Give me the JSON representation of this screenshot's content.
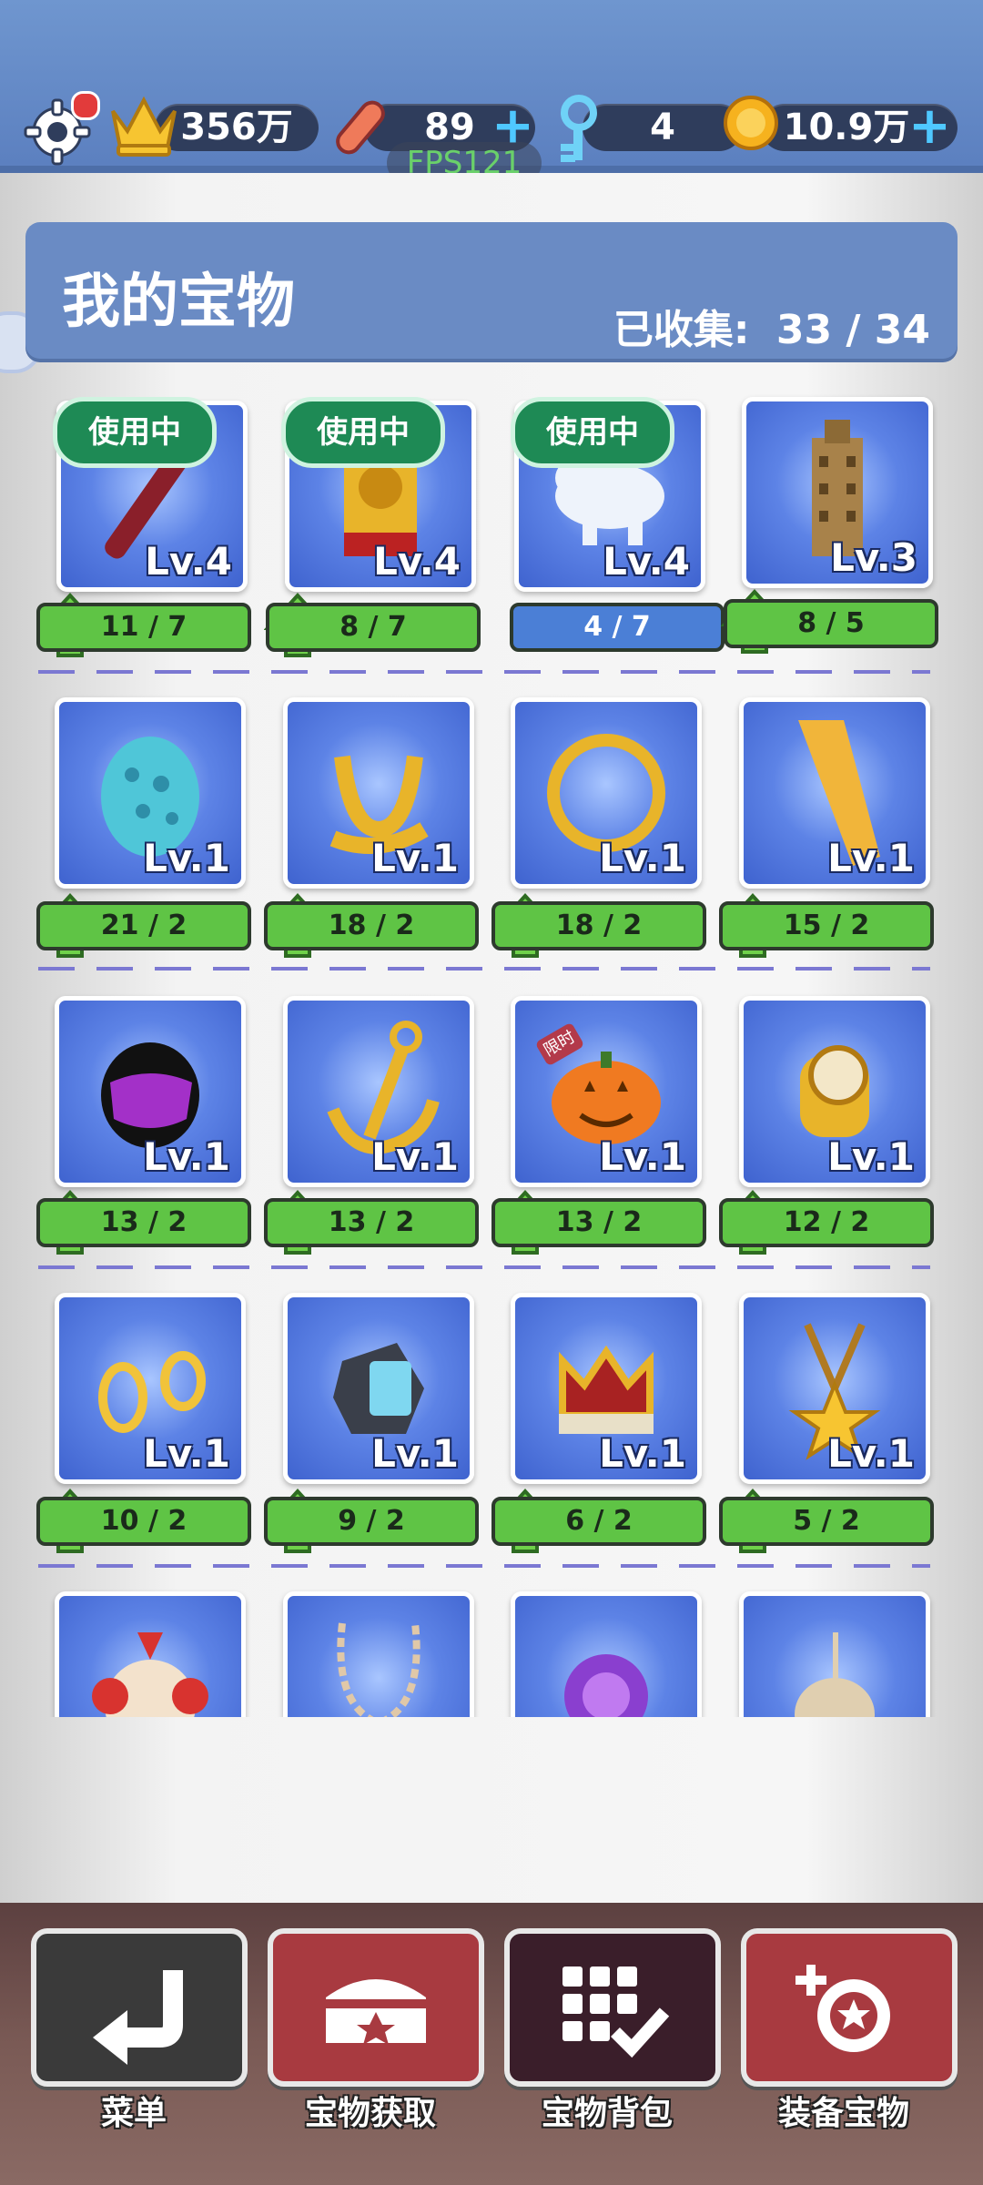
{
  "topbar": {
    "crown_value": "356万",
    "board_value": "89",
    "key_value": "4",
    "coin_value": "10.9万",
    "fps": "FPS121"
  },
  "header": {
    "title": "我的宝物",
    "collected_label": "已收集:",
    "collected_value": "33 / 34"
  },
  "items": [
    {
      "level": "Lv.4",
      "progress": "11 / 7",
      "in_use": "使用中",
      "icon": "staff-icon"
    },
    {
      "level": "Lv.4",
      "progress": "8 / 7",
      "in_use": "使用中",
      "icon": "lion-totem-icon"
    },
    {
      "level": "Lv.4",
      "progress": "4 / 7",
      "in_use": "使用中",
      "icon": "polar-bear-icon"
    },
    {
      "level": "Lv.3",
      "progress": "8 / 5",
      "icon": "skyscraper-icon"
    },
    {
      "level": "Lv.1",
      "progress": "21 / 2",
      "icon": "egg-icon"
    },
    {
      "level": "Lv.1",
      "progress": "18 / 2",
      "icon": "golden-slingshot-icon"
    },
    {
      "level": "Lv.1",
      "progress": "18 / 2",
      "icon": "golden-ring-icon"
    },
    {
      "level": "Lv.1",
      "progress": "15 / 2",
      "icon": "golden-blade-icon"
    },
    {
      "level": "Lv.1",
      "progress": "13 / 2",
      "icon": "helmet-icon"
    },
    {
      "level": "Lv.1",
      "progress": "13 / 2",
      "icon": "anchor-icon"
    },
    {
      "level": "Lv.1",
      "progress": "13 / 2",
      "limited": "限时",
      "icon": "pumpkin-icon"
    },
    {
      "level": "Lv.1",
      "progress": "12 / 2",
      "icon": "watch-icon"
    },
    {
      "level": "Lv.1",
      "progress": "10 / 2",
      "icon": "earrings-icon"
    },
    {
      "level": "Lv.1",
      "progress": "9 / 2",
      "icon": "gadget-icon"
    },
    {
      "level": "Lv.1",
      "progress": "6 / 2",
      "icon": "crown-icon"
    },
    {
      "level": "Lv.1",
      "progress": "5 / 2",
      "icon": "star-necklace-icon"
    },
    {
      "icon": "clown-icon"
    },
    {
      "icon": "necklace-icon"
    },
    {
      "icon": "purple-gem-icon"
    },
    {
      "icon": "bell-icon"
    }
  ],
  "nav": [
    {
      "label": "菜单",
      "icon": "back-arrow-icon"
    },
    {
      "label": "宝物获取",
      "icon": "treasure-chest-icon"
    },
    {
      "label": "宝物背包",
      "icon": "grid-check-icon"
    },
    {
      "label": "装备宝物",
      "icon": "equip-treasure-icon"
    }
  ],
  "colors": {
    "topbar": "#6a8bc4",
    "progress_green": "#5fc445",
    "progress_blue": "#4b7fd6",
    "in_use_badge": "#1e8a55",
    "nav_red": "#a83a40",
    "nav_dark": "#3a1e2a"
  }
}
